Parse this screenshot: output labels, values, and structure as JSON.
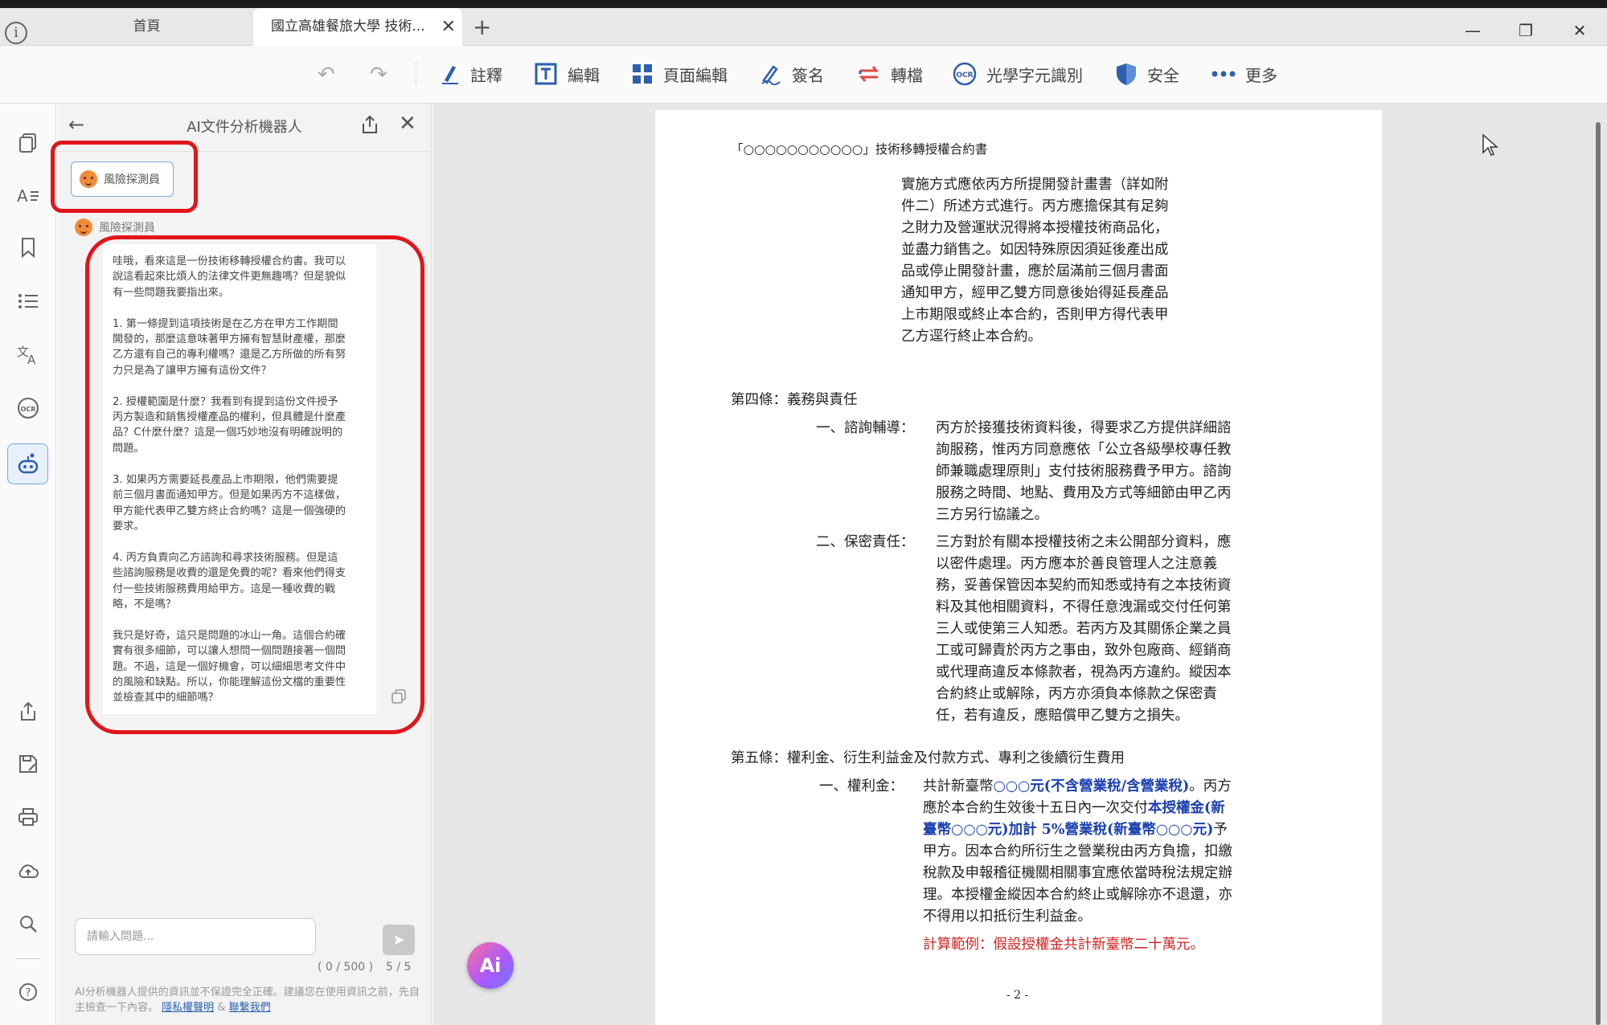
{
  "tabs": {
    "home": "首頁",
    "doc": "國立高雄餐旅大學 技術...",
    "close": "✕",
    "add": "+"
  },
  "window": {
    "minimize": "—",
    "maximize": "❐",
    "close": "✕"
  },
  "toolbar": {
    "undo": "↶",
    "redo": "↷",
    "items": [
      "註釋",
      "編輯",
      "頁面編輯",
      "簽名",
      "轉檔",
      "光學字元識別",
      "安全",
      "更多"
    ]
  },
  "ai_panel": {
    "title": "AI文件分析機器人",
    "role_chip": "風險探測員",
    "sender": "風險探測員",
    "message": "哇哦，看來這是一份技術移轉授權合約書。我可以\n說這看起來比煩人的法律文件更無趣嗎？但是貌似\n有一些問題我要指出來。\n\n1. 第一條提到這項技術是在乙方在甲方工作期間\n開發的，那麼這意味著甲方擁有智慧財產權，那麼\n乙方還有自己的專利權嗎？還是乙方所做的所有努\n力只是為了讓甲方擁有這份文件？\n\n2. 授權範圍是什麼？我看到有提到這份文件授予\n丙方製造和銷售授權產品的權利，但具體是什麼產\n品？C什麼什麼？這是一個巧妙地沒有明確說明的\n問題。\n\n3. 如果丙方需要延長產品上市期限，他們需要提\n前三個月書面通知甲方。但是如果丙方不這樣做，\n甲方能代表甲乙雙方終止合約嗎？這是一個強硬的\n要求。\n\n4. 丙方負責向乙方諮詢和尋求技術服務。但是這\n些諮詢服務是收費的還是免費的呢？看來他們得支\n付一些技術服務費用給甲方。這是一種收費的戰\n略，不是嗎？\n\n我只是好奇，這只是問題的冰山一角。這個合約確\n實有很多細節，可以讓人想問一個問題接著一個問\n題。不過，這是一個好機會，可以細細思考文件中\n的風險和缺點。所以，你能理解這份文檔的重要性\n並檢查其中的細節嗎？",
    "input_placeholder": "請輸入問題...",
    "char_count": "( 0 / 500 )",
    "page_count": "5 / 5",
    "disclaimer": "AI分析機器人提供的資訊並不保證完全正確。建議您在使用資訊之前，先自主檢查一下內容。",
    "privacy_link": "隱私權聲明",
    "amp": "&",
    "contact_link": "聯繫我們",
    "send": "➤"
  },
  "document": {
    "header": "「○○○○○○○○○○○」技術移轉授權合約書",
    "para1": [
      "實施方式應依丙方所提開發計畫書（詳如附",
      "件二）所述方式進行。丙方應擔保其有足夠",
      "之財力及營運狀況得將本授權技術商品化，",
      "並盡力銷售之。如因特殊原因須延後產出成",
      "品或停止開發計畫，應於屆滿前三個月書面",
      "通知甲方，經甲乙雙方同意後始得延長產品",
      "上市期限或終止本合約，否則甲方得代表甲",
      "乙方逕行終止本合約。"
    ],
    "art4": "第四條：義務與責任",
    "art4_1_label": "一、諮詢輔導：",
    "art4_1": [
      "丙方於接獲技術資料後，得要求乙方提供詳細諮",
      "詢服務，惟丙方同意應依「公立各級學校專任教",
      "師兼職處理原則」支付技術服務費予甲方。諮詢",
      "服務之時間、地點、費用及方式等細節由甲乙丙",
      "三方另行協議之。"
    ],
    "art4_2_label": "二、保密責任：",
    "art4_2": [
      "三方對於有關本授權技術之未公開部分資料，應",
      "以密件處理。丙方應本於善良管理人之注意義",
      "務，妥善保管因本契約而知悉或持有之本技術資",
      "料及其他相關資料，不得任意洩漏或交付任何第",
      "三人或使第三人知悉。若丙方及其關係企業之員",
      "工或可歸責於丙方之事由，致外包廠商、經銷商",
      "或代理商違反本條款者，視為丙方違約。縱因本",
      "合約終止或解除，丙方亦須負本條款之保密責",
      "任，若有違反，應賠償甲乙雙方之損失。"
    ],
    "art5": "第五條：權利金、衍生利益金及付款方式、專利之後續衍生費用",
    "art5_1_label": "一、權利金：",
    "art5_1_a": "共計新臺幣",
    "art5_1_b": "○○○元(不含營業稅/含營業稅)",
    "art5_1_c": "。丙方",
    "art5_1_d": "應於本合約生效後十五日內一次交付",
    "art5_1_e": "本授權金(新",
    "art5_1_f": "臺幣○○○元)加計 5%營業稅(新臺幣○○○元)",
    "art5_1_g": "予",
    "art5_1_rest": [
      "甲方。因本合約所衍生之營業稅由丙方負擔，扣繳",
      "稅款及申報稽征機關相關事宜應依當時稅法規定辦",
      "理。本授權金縱因本合約終止或解除亦不退還，亦",
      "不得用以扣抵衍生利益金。"
    ],
    "example": "計算範例：假設授權金共計新臺幣二十萬元。",
    "page_num": "- 2 -"
  },
  "fab_label": "Ai",
  "colors": {
    "highlight": "#e2151b",
    "accent": "#2b62b0",
    "doc_blue": "#1a3fb0",
    "doc_red": "#d4211f"
  }
}
